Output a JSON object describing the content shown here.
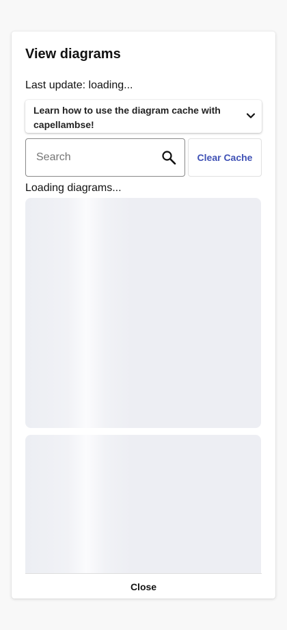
{
  "dialog": {
    "title": "View diagrams",
    "last_update": "Last update: loading...",
    "accordion": {
      "label": "Learn how to use the diagram cache with capellambse!",
      "icon": "chevron-down-icon"
    },
    "search": {
      "placeholder": "Search",
      "value": "",
      "icon": "search-icon"
    },
    "clear_cache_label": "Clear Cache",
    "loading_text": "Loading diagrams...",
    "close_label": "Close",
    "colors": {
      "accent": "#3f51b5",
      "skeleton": "#edeef3"
    }
  }
}
